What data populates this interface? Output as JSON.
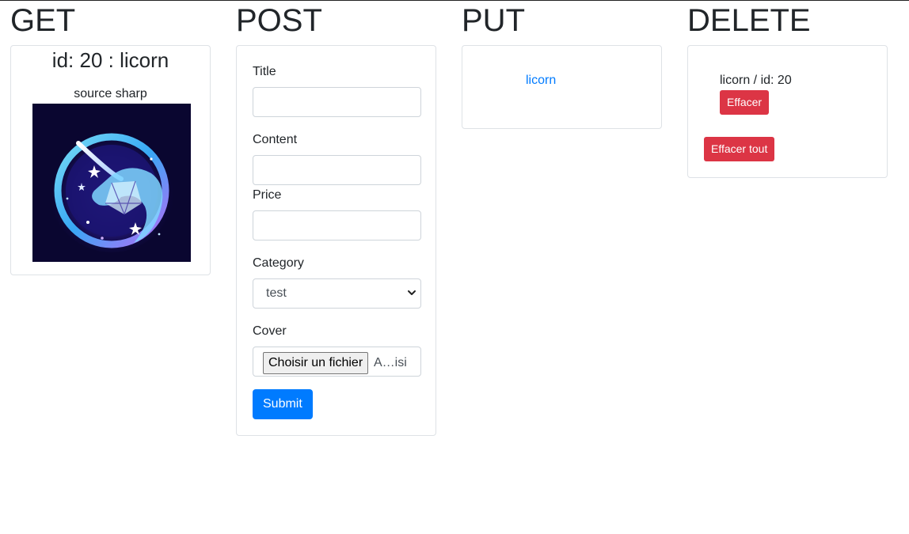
{
  "columns": {
    "get": {
      "heading": "GET",
      "item_title": "id: 20 : licorn",
      "source_label": "source sharp",
      "image_name": "unicorn-logo-image"
    },
    "post": {
      "heading": "POST",
      "fields": {
        "title_label": "Title",
        "title_value": "",
        "content_label": "Content",
        "content_value": "",
        "price_label": "Price",
        "price_value": "",
        "category_label": "Category",
        "category_selected": "test",
        "cover_label": "Cover",
        "file_button": "Choisir un fichier",
        "file_status": "A…isi"
      },
      "submit_label": "Submit"
    },
    "put": {
      "heading": "PUT",
      "link_text": "licorn"
    },
    "delete": {
      "heading": "DELETE",
      "item_text": "licorn / id: 20",
      "delete_button": "Effacer",
      "delete_all_button": "Effacer tout"
    }
  },
  "colors": {
    "primary": "#007bff",
    "danger": "#dc3545",
    "border": "#dee2e6",
    "text": "#212529"
  }
}
